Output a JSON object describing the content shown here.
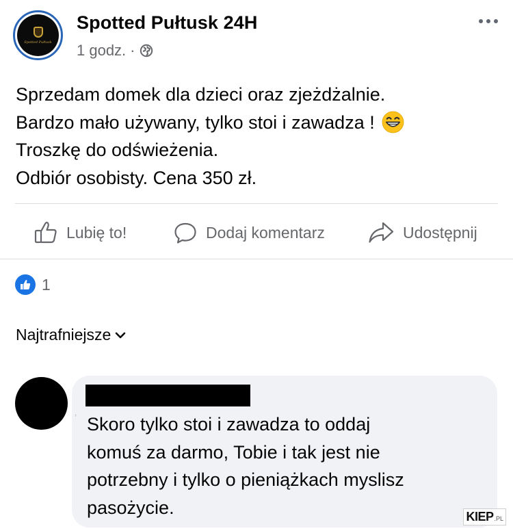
{
  "post": {
    "page_name": "Spotted Pułtusk 24H",
    "time": "1 godz.",
    "separator": "·",
    "avatar_text": "Spotted Pułtusk",
    "text_lines": [
      "Sprzedam domek dla dzieci oraz  zjeżdżalnie.",
      "Bardzo mało używany, tylko stoi i zawadza !",
      "Troszkę do odświeżenia.",
      "Odbiór osobisty. Cena 350 zł."
    ],
    "emoji": "grinning-face-with-smiling-eyes"
  },
  "actions": {
    "like": "Lubię to!",
    "comment": "Dodaj komentarz",
    "share": "Udostępnij"
  },
  "reactions": {
    "count": "1",
    "icon": "like-badge-icon",
    "color": "#1b74e4"
  },
  "comments": {
    "sort_label": "Najtrafniejsze",
    "items": [
      {
        "author_redacted": true,
        "text_lines": [
          "Skoro tylko stoi i zawadza to oddaj",
          "komuś za darmo, Tobie i tak jest nie",
          "potrzebny i tylko o pieniążkach myslisz",
          "pasożycie."
        ]
      }
    ]
  },
  "watermark": {
    "main": "KIEP",
    "suffix": ".PL"
  },
  "colors": {
    "text": "#050505",
    "secondary": "#65676b",
    "bubble": "#f0f2f5",
    "accent": "#1b74e4"
  }
}
